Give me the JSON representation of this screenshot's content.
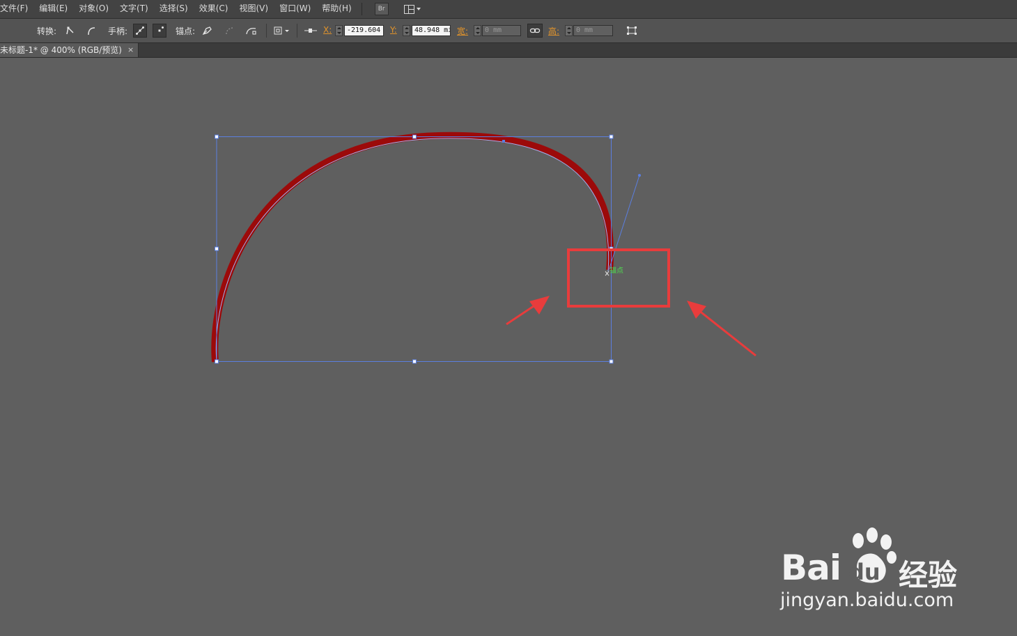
{
  "menubar": {
    "items": [
      "文件(F)",
      "编辑(E)",
      "对象(O)",
      "文字(T)",
      "选择(S)",
      "效果(C)",
      "视图(V)",
      "窗口(W)",
      "帮助(H)"
    ],
    "bridge_label": "Br"
  },
  "controlbar": {
    "convert_label": "转换:",
    "handles_label": "手柄:",
    "anchors_label": "锚点:",
    "x_label": "X:",
    "x_value": "-219.604",
    "y_label": "Y:",
    "y_value": "48.948 mi",
    "w_label": "宽:",
    "w_value": "0 mm",
    "h_label": "高:",
    "h_value": "0 mm"
  },
  "document_tab": {
    "title": "未标题-1* @ 400% (RGB/预览)",
    "close": "×"
  },
  "canvas": {
    "anchor_tooltip": "锚点",
    "stroke_color": "#9c0a0a",
    "path_color": "#5b7fe0",
    "highlight_color": "#e83c3c",
    "arrow_color": "#e83c3c"
  },
  "watermark": {
    "brand": "Bai",
    "brand_suffix": "du",
    "chinese": "经验",
    "url": "jingyan.baidu.com"
  }
}
